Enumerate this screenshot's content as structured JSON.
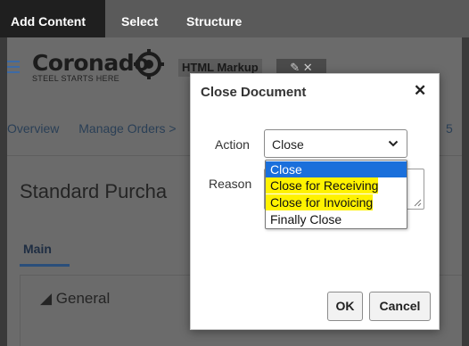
{
  "topbar": {
    "tabs": [
      "Add Content",
      "Select",
      "Structure"
    ]
  },
  "header": {
    "logo_name": "Coronado",
    "logo_tagline": "STEEL STARTS HERE",
    "html_markup": "HTML Markup",
    "markup_actions": "✎ ✕"
  },
  "nav": {
    "items": [
      "Overview",
      "Manage Orders >"
    ],
    "right_fragment": "5"
  },
  "page": {
    "title": "Standard Purcha",
    "main_tab": "Main",
    "section": "◢ General"
  },
  "dialog": {
    "title": "Close Document",
    "close_glyph": "✕",
    "action_label": "Action",
    "reason_label": "Reason",
    "selected_action": "Close",
    "options": [
      "Close",
      "Close for Receiving",
      "Close for Invoicing",
      "Finally Close"
    ],
    "ok_label": "OK",
    "cancel_label": "Cancel"
  },
  "colors": {
    "selection_blue": "#1a6fdb",
    "highlight_yellow": "#fff200",
    "nav_blue": "#3d6aa5"
  }
}
